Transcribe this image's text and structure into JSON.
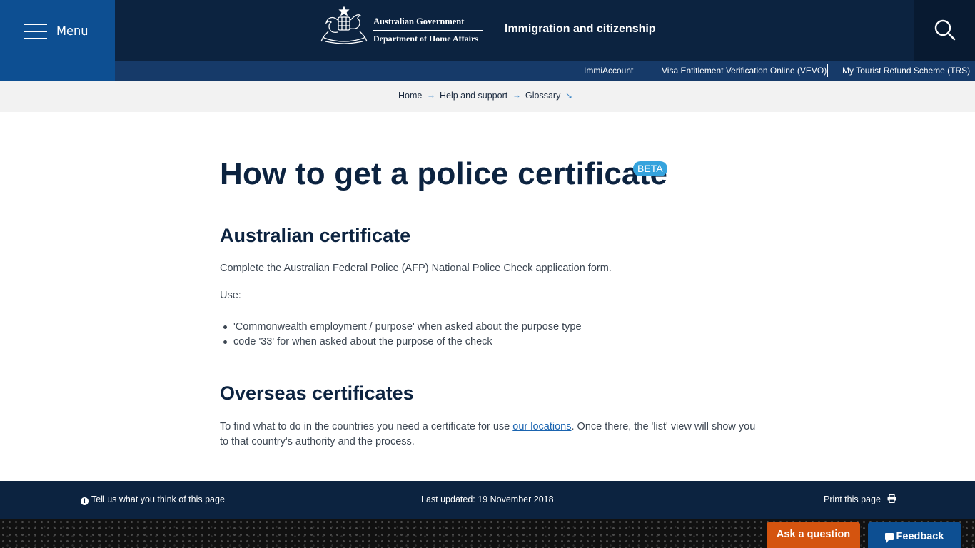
{
  "header": {
    "menu_label": "Menu",
    "gov_name": "Australian Government",
    "dept_name": "Department of Home Affairs",
    "site_title": "Immigration and citizenship",
    "utility_links": [
      "ImmiAccount",
      "Visa Entitlement Verification Online (VEVO)",
      "My Tourist Refund Scheme (TRS)"
    ]
  },
  "breadcrumb": [
    "Home",
    "Help and support",
    "Glossary"
  ],
  "main": {
    "title": "How to get a police certificate",
    "badge": "BETA",
    "section1": {
      "heading": "Australian certificate",
      "intro": "Complete the Australian Federal Police (AFP) National Police Check application form.",
      "use_label": "Use:",
      "bullets": [
        "'Commonwealth employment / purpose' when asked about the purpose type",
        "code '33' for when asked about the purpose of the check"
      ]
    },
    "section2": {
      "heading": "Overseas certificates",
      "text_before": "To find what to do in the countries you need a certificate for use ",
      "link": "our locations",
      "text_after": ". Once there, the 'list' view will show you to that country's authority and the process."
    }
  },
  "footer": {
    "feedback_prompt": "Tell us what you think of this page",
    "last_updated": "Last updated: 19 November 2018",
    "print": "Print this page",
    "ask_question": "Ask a question",
    "feedback": "Feedback"
  },
  "colors": {
    "header_navy": "#0c2340",
    "menu_blue": "#0d4f92",
    "utility_blue": "#163a69",
    "badge_blue": "#35a3dd",
    "ask_orange": "#d4540f"
  }
}
